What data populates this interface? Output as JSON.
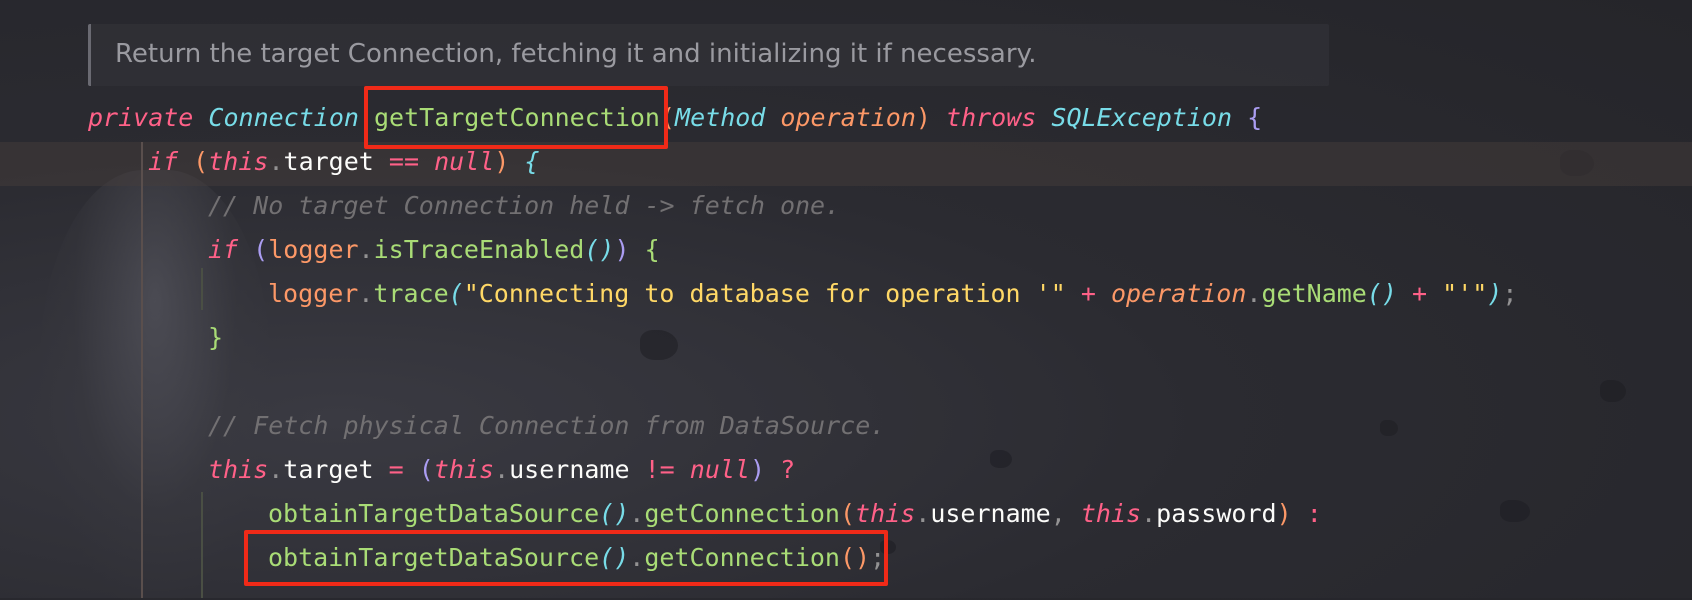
{
  "doc_comment": "Return the target Connection, fetching it and initializing it if necessary.",
  "colors": {
    "keyword": "#ff6188",
    "type": "#78dce8",
    "parameter": "#fc9867",
    "function": "#a9dc76",
    "string": "#ffd866",
    "comment": "#727072",
    "highlight_box": "#f02a18"
  },
  "code": {
    "line1": {
      "private": "private",
      "ret_type": "Connection",
      "method": "getTargetConnection",
      "open": "(",
      "param_type": "Method",
      "param": "operation",
      "close": ")",
      "throws": "throws",
      "exception": "SQLException",
      "brace": "{"
    },
    "line2": {
      "if": "if",
      "open": "(",
      "this": "this",
      "dot": ".",
      "field": "target",
      "op": "==",
      "null": "null",
      "close": ")",
      "brace": "{"
    },
    "line3": {
      "comment": "// No target Connection held -> fetch one."
    },
    "line4": {
      "if": "if",
      "open": "(",
      "logger": "logger",
      "dot": ".",
      "call": "isTraceEnabled",
      "parens": "()",
      "close": ")",
      "brace": "{"
    },
    "line5": {
      "logger": "logger",
      "dot": ".",
      "call": "trace",
      "open": "(",
      "string1": "\"Connecting to database for operation '\"",
      "plus1": "+",
      "param": "operation",
      "dot2": ".",
      "call2": "getName",
      "parens": "()",
      "plus2": "+",
      "string2": "\"'\"",
      "close": ")",
      "semi": ";"
    },
    "line6": {
      "brace": "}"
    },
    "line7": {
      "comment": "// Fetch physical Connection from DataSource."
    },
    "line8": {
      "this": "this",
      "dot": ".",
      "field": "target",
      "eq": "=",
      "open": "(",
      "this2": "this",
      "dot2": ".",
      "field2": "username",
      "op": "!=",
      "null": "null",
      "close": ")",
      "q": "?"
    },
    "line9": {
      "call1": "obtainTargetDataSource",
      "parens1": "()",
      "dot": ".",
      "call2": "getConnection",
      "open": "(",
      "this1": "this",
      "dot2": ".",
      "field1": "username",
      "comma": ",",
      "this2": "this",
      "dot3": ".",
      "field2": "password",
      "close": ")",
      "colon": ":"
    },
    "line10": {
      "call1": "obtainTargetDataSource",
      "parens1": "()",
      "dot": ".",
      "call2": "getConnection",
      "parens2": "()",
      "semi": ";"
    }
  }
}
